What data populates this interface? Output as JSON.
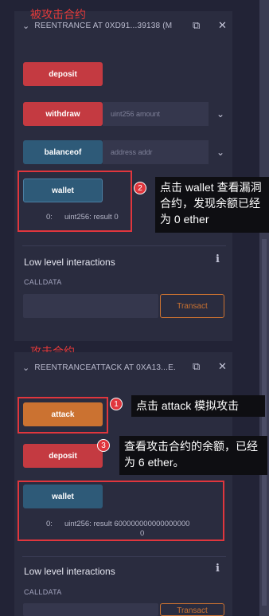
{
  "annotations": {
    "victim_title": "被攻击合约",
    "attack_title": "攻击合约",
    "note2": "点击 wallet 查看漏洞合约，发现余额已经为 0 ether",
    "note1": "点击 attack 模拟攻击",
    "note3": "查看攻击合约的余额，已经为 6 ether。",
    "badge1": "1",
    "badge2": "2",
    "badge3": "3"
  },
  "contract1": {
    "header": "REENTRANCE AT 0XD91...39138 (M",
    "deposit": "deposit",
    "withdraw": "withdraw",
    "withdraw_placeholder": "uint256 amount",
    "balanceof": "balanceof",
    "balanceof_placeholder": "address addr",
    "wallet": "wallet",
    "result_index": "0:",
    "result": "uint256: result 0",
    "low_level": "Low level interactions",
    "calldata": "CALLDATA",
    "transact": "Transact"
  },
  "contract2": {
    "header": "REENTRANCEATTACK AT 0XA13...E.",
    "attack": "attack",
    "deposit": "deposit",
    "wallet": "wallet",
    "result_index": "0:",
    "result_line1": "uint256: result 600000000000000000",
    "result_line2": "0",
    "low_level": "Low level interactions",
    "calldata": "CALLDATA",
    "transact": "Transact"
  },
  "icons": {
    "copy": "copy-icon",
    "close": "close-icon",
    "chevron": "chevron-down-icon",
    "info": "info-icon"
  }
}
